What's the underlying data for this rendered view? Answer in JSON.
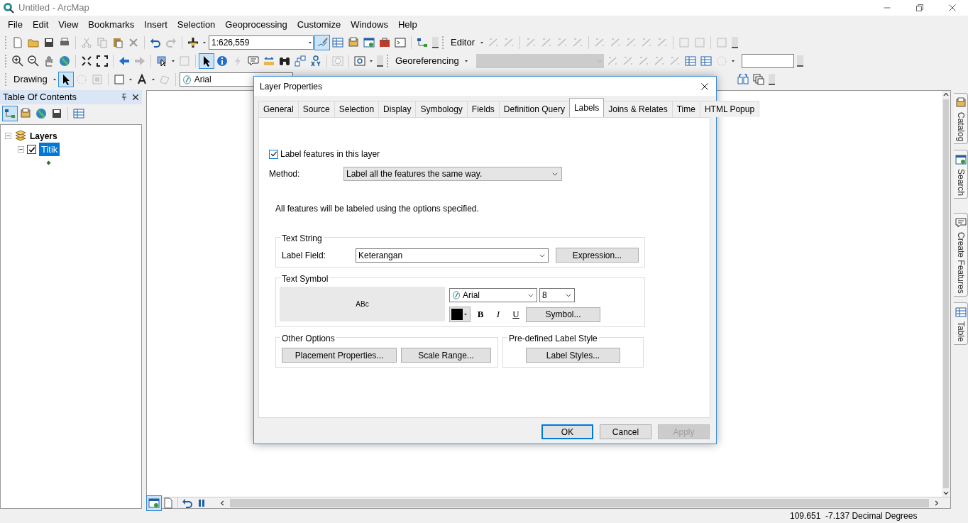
{
  "window": {
    "title": "Untitled - ArcMap"
  },
  "menu": [
    "File",
    "Edit",
    "View",
    "Bookmarks",
    "Insert",
    "Selection",
    "Geoprocessing",
    "Customize",
    "Windows",
    "Help"
  ],
  "toolbar_1": {
    "scale": "1:626,559",
    "editor_menu": "Editor"
  },
  "toolbar_2": {
    "georeferencing_menu": "Georeferencing"
  },
  "toolbar_3": {
    "drawing_menu": "Drawing",
    "font": "Arial"
  },
  "toc": {
    "title": "Table Of Contents",
    "tree": [
      {
        "label": "Layers",
        "expanded": true,
        "children": [
          {
            "label": "Titik",
            "checked": true,
            "selected": true,
            "expanded": true
          }
        ]
      }
    ]
  },
  "side_tabs": [
    "Catalog",
    "Search",
    "Create Features",
    "Table"
  ],
  "status_bar": {
    "coordinates": "109.651  -7.137 Decimal Degrees"
  },
  "dialog": {
    "title": "Layer Properties",
    "tabs": [
      {
        "label": "General",
        "selected": false
      },
      {
        "label": "Source",
        "selected": false
      },
      {
        "label": "Selection",
        "selected": false
      },
      {
        "label": "Display",
        "selected": false
      },
      {
        "label": "Symbology",
        "selected": false
      },
      {
        "label": "Fields",
        "selected": false
      },
      {
        "label": "Definition Query",
        "selected": false
      },
      {
        "label": "Labels",
        "selected": true
      },
      {
        "label": "Joins & Relates",
        "selected": false
      },
      {
        "label": "Time",
        "selected": false
      },
      {
        "label": "HTML Popup",
        "selected": false
      }
    ],
    "label_features": {
      "label": "Label features in this layer",
      "checked": true
    },
    "method": {
      "label": "Method:",
      "value": "Label all the features the same way."
    },
    "info": "All features will be labeled using the options specified.",
    "text_string": {
      "title": "Text String",
      "field_label": "Label Field:",
      "field_value": "Keterangan",
      "button": "Expression..."
    },
    "text_symbol": {
      "title": "Text Symbol",
      "preview": "ABc",
      "font": "Arial",
      "size": "8",
      "bold": "B",
      "italic": "I",
      "underline": "U",
      "button": "Symbol..."
    },
    "other_options": {
      "title": "Other Options",
      "buttons": [
        "Placement Properties...",
        "Scale Range..."
      ]
    },
    "predefined": {
      "title": "Pre-defined Label Style",
      "button": "Label Styles..."
    },
    "buttons": [
      {
        "label": "OK",
        "disabled": false,
        "default": true
      },
      {
        "label": "Cancel",
        "disabled": false,
        "default": false
      },
      {
        "label": "Apply",
        "disabled": true,
        "default": false
      }
    ]
  }
}
